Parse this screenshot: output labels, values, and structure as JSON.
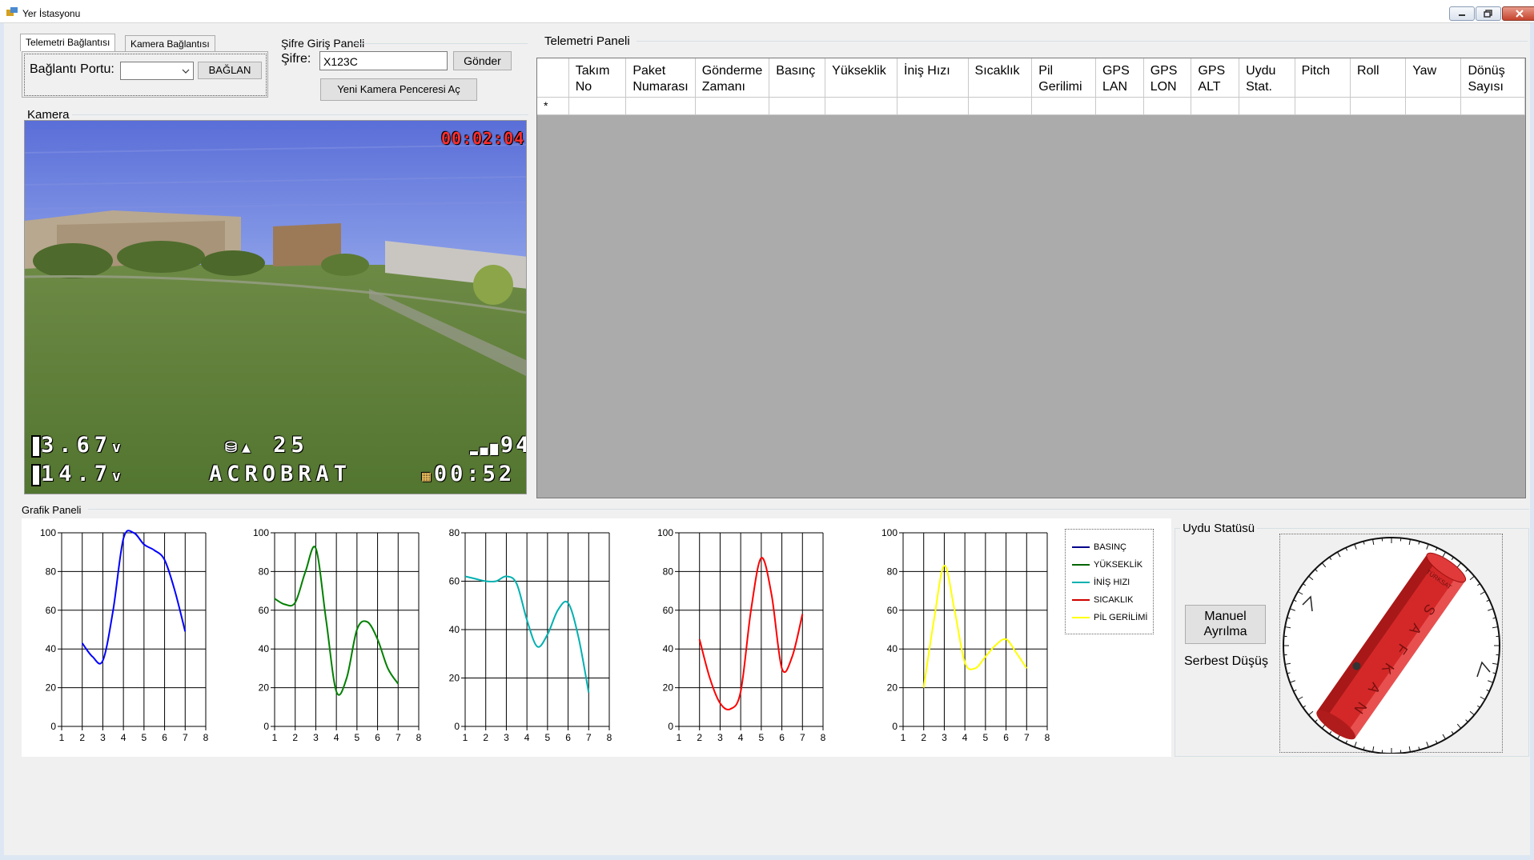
{
  "window": {
    "title": "Yer İstasyonu"
  },
  "tabs": {
    "telemetry_tab": "Telemetri Bağlantısı",
    "camera_tab": "Kamera Bağlantısı",
    "port_label": "Bağlantı Portu:",
    "port_value": "",
    "connect_button": "BAĞLAN"
  },
  "password_panel": {
    "title": "Şifre Giriş Paneli",
    "label": "Şifre:",
    "value": "X123C",
    "send_button": "Gönder",
    "new_camera_button": "Yeni Kamera Penceresi Aç"
  },
  "camera": {
    "title": "Kamera",
    "osd": {
      "timer_top": "00:02:04",
      "cell_voltage": "3.67",
      "battery_voltage": "14.7",
      "voltage_unit": "v",
      "satellites": "25",
      "rssi": "94",
      "mode": "ACROBRAT",
      "flight_time": "00:52"
    }
  },
  "telemetry": {
    "title": "Telemetri Paneli",
    "columns": [
      "Takım\nNo",
      "Paket\nNumarası",
      "Gönderme\nZamanı",
      "Basınç",
      "Yükseklik",
      "İniş Hızı",
      "Sıcaklık",
      "Pil\nGerilimi",
      "GPS\nLAN",
      "GPS\nLON",
      "GPS\nALT",
      "Uydu\nStat.",
      "Pitch",
      "Roll",
      "Yaw",
      "Dönüş\nSayısı"
    ],
    "new_row_marker": "*"
  },
  "charts_panel": {
    "title": "Grafik Paneli"
  },
  "chart_data": [
    {
      "type": "line",
      "series": [
        {
          "name": "BASINÇ",
          "color": "#0000ff",
          "x": [
            2,
            2.5,
            3,
            3.5,
            4,
            4.5,
            5,
            5.5,
            6,
            6.5,
            7
          ],
          "values": [
            43,
            36,
            34,
            60,
            97,
            100,
            94,
            91,
            86,
            70,
            49
          ]
        }
      ],
      "xlim": [
        1,
        8
      ],
      "ylim": [
        0,
        100
      ],
      "xticks": [
        1,
        2,
        3,
        4,
        5,
        6,
        7,
        8
      ],
      "yticks": [
        0,
        20,
        40,
        60,
        80,
        100
      ],
      "grid": true
    },
    {
      "type": "line",
      "series": [
        {
          "name": "YÜKSEKLİK",
          "color": "#008000",
          "x": [
            1,
            1.5,
            2,
            2.5,
            3,
            3.5,
            4,
            4.5,
            5,
            5.5,
            6,
            6.5,
            7
          ],
          "values": [
            66,
            63,
            64,
            80,
            92,
            55,
            18,
            25,
            50,
            54,
            45,
            30,
            22
          ]
        }
      ],
      "xlim": [
        1,
        8
      ],
      "ylim": [
        0,
        100
      ],
      "xticks": [
        1,
        2,
        3,
        4,
        5,
        6,
        7,
        8
      ],
      "yticks": [
        0,
        20,
        40,
        60,
        80,
        100
      ],
      "grid": true
    },
    {
      "type": "line",
      "series": [
        {
          "name": "İNİŞ HIZI",
          "color": "#00b0b0",
          "x": [
            1,
            1.5,
            2,
            2.5,
            3,
            3.5,
            4,
            4.5,
            5,
            5.5,
            6,
            6.5,
            7
          ],
          "values": [
            62,
            61,
            60,
            60,
            62,
            59,
            44,
            33,
            38,
            48,
            51,
            37,
            14
          ]
        }
      ],
      "xlim": [
        1,
        8
      ],
      "ylim": [
        0,
        80
      ],
      "xticks": [
        1,
        2,
        3,
        4,
        5,
        6,
        7,
        8
      ],
      "yticks": [
        0,
        20,
        40,
        60,
        80
      ],
      "grid": true
    },
    {
      "type": "line",
      "series": [
        {
          "name": "SICAKLIK",
          "color": "#ff0000",
          "x": [
            2,
            2.5,
            3,
            3.5,
            4,
            4.5,
            5,
            5.5,
            6,
            6.5,
            7
          ],
          "values": [
            45,
            25,
            12,
            9,
            18,
            60,
            87,
            68,
            30,
            36,
            58
          ]
        }
      ],
      "xlim": [
        1,
        8
      ],
      "ylim": [
        0,
        100
      ],
      "xticks": [
        1,
        2,
        3,
        4,
        5,
        6,
        7,
        8
      ],
      "yticks": [
        0,
        20,
        40,
        60,
        80,
        100
      ],
      "grid": true
    },
    {
      "type": "line",
      "series": [
        {
          "name": "PİL GERİLİMİ",
          "color": "#ffff00",
          "x": [
            2,
            2.5,
            3,
            3.5,
            4,
            4.5,
            5,
            5.5,
            6,
            6.5,
            7
          ],
          "values": [
            20,
            55,
            83,
            60,
            33,
            30,
            36,
            42,
            45,
            38,
            30
          ]
        }
      ],
      "xlim": [
        1,
        8
      ],
      "ylim": [
        0,
        100
      ],
      "xticks": [
        1,
        2,
        3,
        4,
        5,
        6,
        7,
        8
      ],
      "yticks": [
        0,
        20,
        40,
        60,
        80,
        100
      ],
      "grid": true
    }
  ],
  "legend": [
    {
      "label": "BASINÇ",
      "color": "#00008b"
    },
    {
      "label": "YÜKSEKLİK",
      "color": "#006400"
    },
    {
      "label": "İNİŞ HIZI",
      "color": "#00b0b0"
    },
    {
      "label": "SICAKLIK",
      "color": "#d00000"
    },
    {
      "label": "PİL GERİLİMİ",
      "color": "#ffff00"
    }
  ],
  "satellite": {
    "title": "Uydu Statüsü",
    "manual_button": "Manuel\nAyrılma",
    "status_text": "Serbest Düşüş",
    "model_text": "SAFKAN",
    "model_logo": "TÜRKSAT"
  }
}
